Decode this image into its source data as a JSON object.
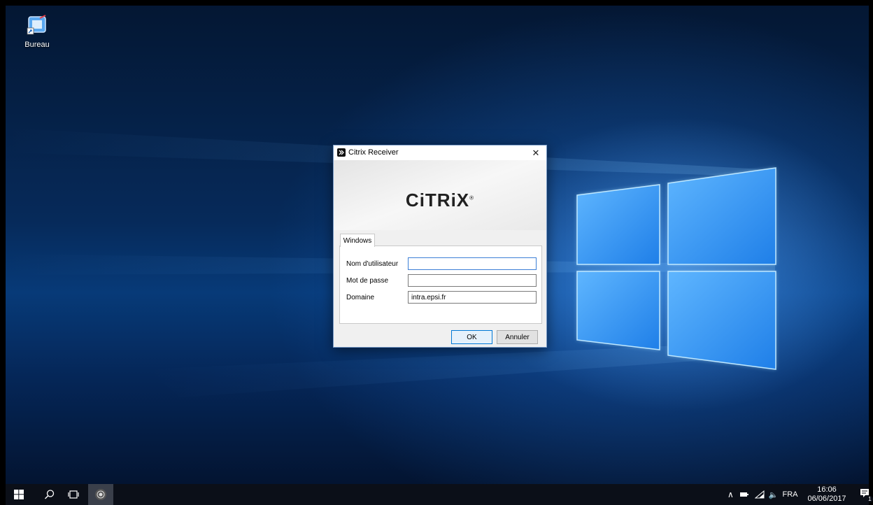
{
  "desktop": {
    "shortcut_label": "Bureau"
  },
  "dialog": {
    "title": "Citrix Receiver",
    "logo_text": "CiTRiX",
    "tab_label": "Windows",
    "fields": {
      "username_label": "Nom d'utilisateur",
      "username_value": "",
      "password_label": "Mot de passe",
      "password_value": "",
      "domain_label": "Domaine",
      "domain_value": "intra.epsi.fr"
    },
    "ok_label": "OK",
    "cancel_label": "Annuler"
  },
  "taskbar": {
    "language": "FRA",
    "time": "16:06",
    "date": "06/06/2017",
    "notification_count": "1"
  }
}
